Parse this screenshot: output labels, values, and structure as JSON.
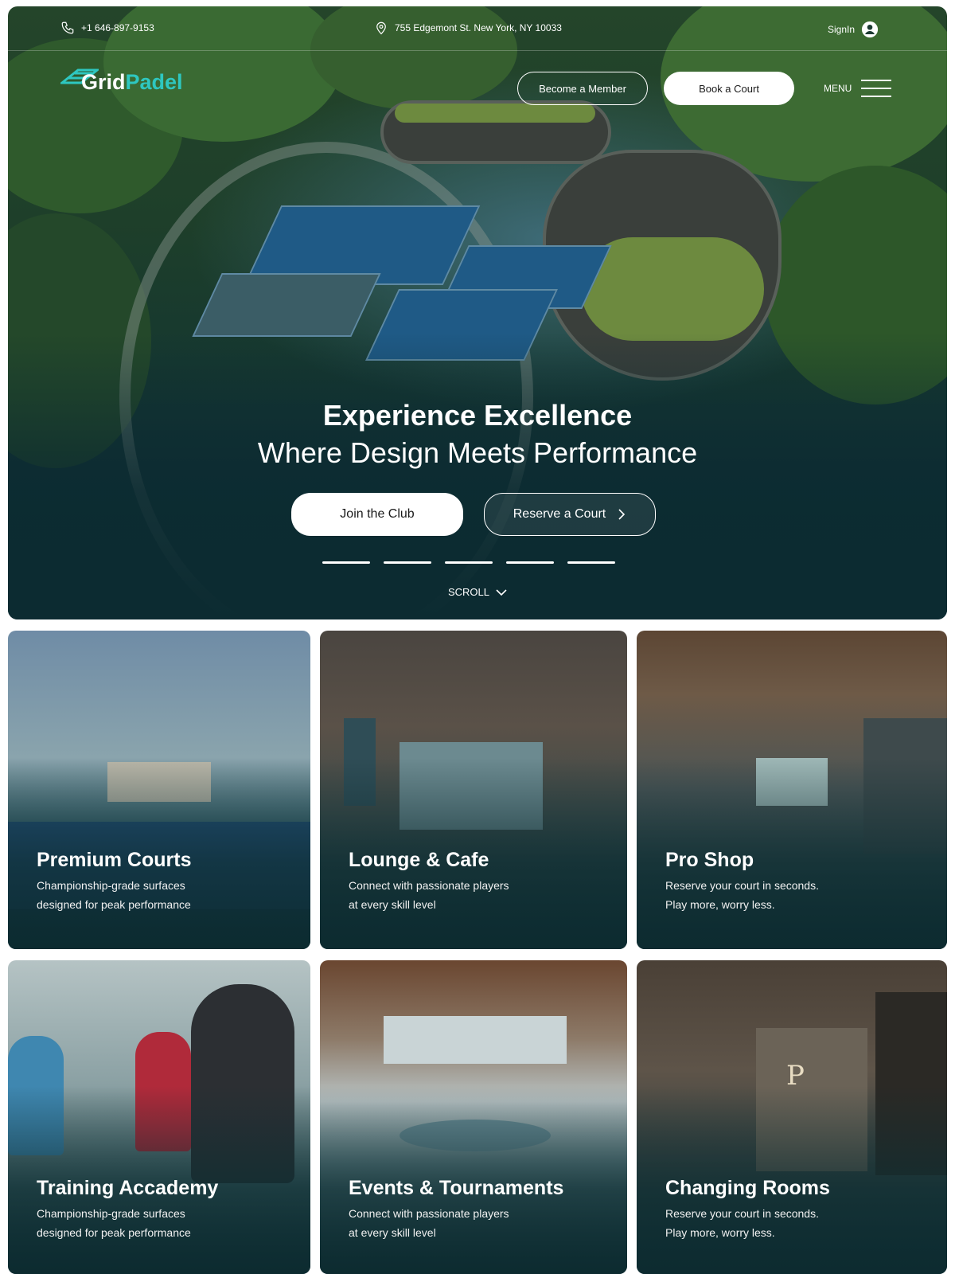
{
  "topbar": {
    "phone": "+1 646-897-9153",
    "address": "755 Edgemont St. New York, NY 10033",
    "signin": "SignIn"
  },
  "brand": {
    "part1": "Grid",
    "part2": "Padel"
  },
  "nav": {
    "become_member": "Become a Member",
    "book_court": "Book a Court",
    "menu": "MENU"
  },
  "hero": {
    "title": "Experience Excellence",
    "subtitle": "Where Design Meets Performance",
    "join": "Join the Club",
    "reserve": "Reserve a Court",
    "scroll": "SCROLL",
    "slide_count": 5
  },
  "cards": [
    {
      "title": "Premium Courts",
      "line1": "Championship-grade surfaces",
      "line2": "designed for peak performance"
    },
    {
      "title": "Lounge & Cafe",
      "line1": "Connect with passionate players",
      "line2": "at every skill level"
    },
    {
      "title": "Pro Shop",
      "line1": "Reserve your court in seconds.",
      "line2": "Play more, worry less."
    },
    {
      "title": "Training Accademy",
      "line1": "Championship-grade surfaces",
      "line2": "designed for peak performance"
    },
    {
      "title": "Events & Tournaments",
      "line1": "Connect with passionate players",
      "line2": "at every skill level"
    },
    {
      "title": "Changing Rooms",
      "line1": "Reserve your court in seconds.",
      "line2": "Play more, worry less."
    }
  ],
  "colors": {
    "brand_accent": "#2ec7c0",
    "deep_teal": "#0c2b31"
  },
  "icons": [
    "phone-icon",
    "location-pin-icon",
    "user-circle-icon",
    "menu-icon",
    "chevron-right-icon",
    "chevron-down-icon"
  ]
}
